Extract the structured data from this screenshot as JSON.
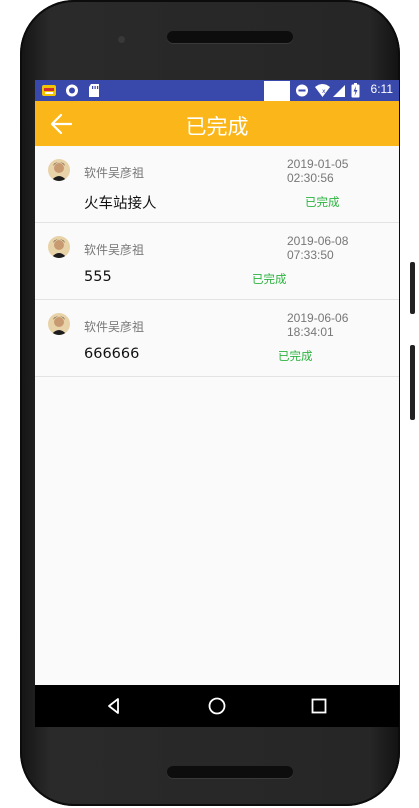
{
  "statusbar": {
    "time": "6:11",
    "icons": [
      "app-notification-icon",
      "circle-notification-icon",
      "sd-card-icon",
      "do-not-disturb-icon",
      "wifi-icon",
      "signal-icon",
      "battery-icon"
    ]
  },
  "appbar": {
    "title": "已完成",
    "back_icon": "arrow-left-icon"
  },
  "orders": [
    {
      "name": "软件吴彦祖",
      "date": "2019-01-05",
      "time": "02:30:56",
      "content": "火车站接人",
      "status": "已完成"
    },
    {
      "name": "软件吴彦祖",
      "date": "2019-06-08",
      "time": "07:33:50",
      "content": "555",
      "status": "已完成"
    },
    {
      "name": "软件吴彦祖",
      "date": "2019-06-06",
      "time": "18:34:01",
      "content": "666666",
      "status": "已完成"
    }
  ],
  "navigation": {
    "back": "triangle-back-icon",
    "home": "circle-home-icon",
    "recents": "square-recents-icon"
  },
  "colors": {
    "appbar": "#fbb71a",
    "statusbar": "#3949ab",
    "status_done": "#2bb33f",
    "navbar": "#000000"
  }
}
